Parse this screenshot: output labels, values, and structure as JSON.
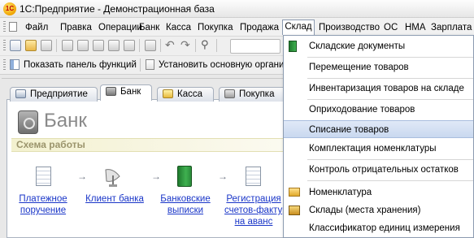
{
  "window": {
    "title": "1С:Предприятие - Демонстрационная база",
    "app_icon_text": "1С"
  },
  "menubar": {
    "items": [
      {
        "label": "Файл"
      },
      {
        "label": "Правка"
      },
      {
        "label": "Операции"
      },
      {
        "label": "Банк"
      },
      {
        "label": "Касса"
      },
      {
        "label": "Покупка"
      },
      {
        "label": "Продажа"
      },
      {
        "label": "Склад"
      },
      {
        "label": "Производство"
      },
      {
        "label": "ОС"
      },
      {
        "label": "НМА"
      },
      {
        "label": "Зарплата"
      }
    ],
    "open_menu": "Склад"
  },
  "toolbar2": {
    "show_panel_label": "Показать панель функций",
    "set_main_label": "Установить основную органи"
  },
  "tabs": [
    {
      "label": "Предприятие",
      "icon": "building-icon",
      "active": false
    },
    {
      "label": "Банк",
      "icon": "bank-icon",
      "active": true
    },
    {
      "label": "Касса",
      "icon": "cash-icon",
      "active": false
    },
    {
      "label": "Покупка",
      "icon": "truck-icon",
      "active": false
    }
  ],
  "panel": {
    "title": "Банк",
    "scheme_title": "Схема работы",
    "flow": [
      {
        "line1": "Платежное",
        "line2": "поручение",
        "icon": "document-icon"
      },
      {
        "line1": "Клиент банка",
        "line2": "",
        "icon": "satellite-icon"
      },
      {
        "line1": "Банковские",
        "line2": "выписки",
        "icon": "green-book-icon"
      },
      {
        "line1": "Регистрация",
        "line2": "счетов-фактур",
        "line3": "на аванс",
        "icon": "document-icon"
      }
    ]
  },
  "dropdown": {
    "items": [
      {
        "label": "Складские документы",
        "icon": "green-book-icon",
        "highlighted": false
      },
      {
        "label": "Перемещение товаров",
        "highlighted": false
      },
      {
        "label": "Инвентаризация товаров на складе",
        "highlighted": false
      },
      {
        "label": "Оприходование товаров",
        "highlighted": false
      },
      {
        "label": "Списание товаров",
        "highlighted": true
      },
      {
        "label": "Комплектация номенклатуры",
        "highlighted": false
      },
      {
        "label": "Контроль отрицательных остатков",
        "highlighted": false
      },
      {
        "label": "Номенклатура",
        "icon": "catalog-icon",
        "highlighted": false
      },
      {
        "label": "Склады (места хранения)",
        "icon": "warehouse-icon",
        "highlighted": false
      },
      {
        "label": "Классификатор единиц измерения",
        "highlighted": false
      }
    ]
  },
  "colors": {
    "link": "#1a36c8",
    "highlight": "#c9d8ef",
    "scheme_header": "#f3f1cf"
  }
}
